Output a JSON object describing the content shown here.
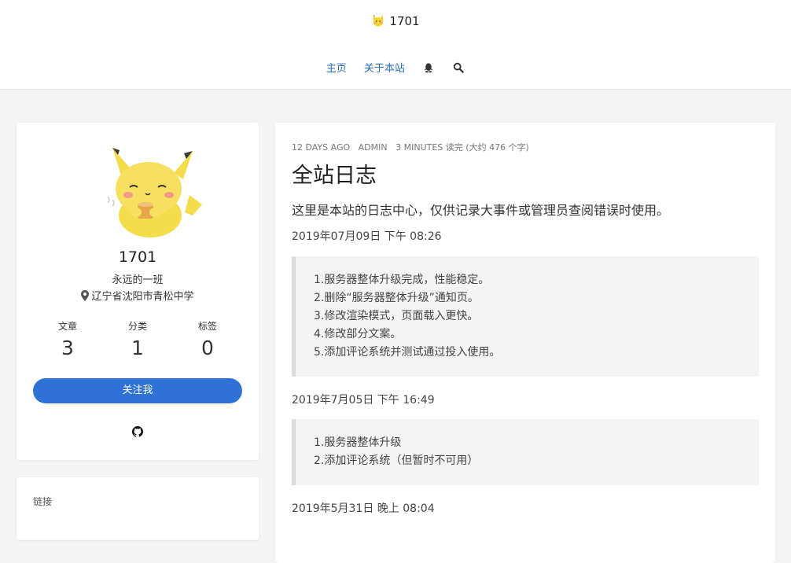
{
  "site": {
    "title": "1701",
    "logo_icon": "pikachu-icon"
  },
  "nav": {
    "home": "主页",
    "about": "关于本站",
    "qq_icon": "qq-icon",
    "search_icon": "search-icon"
  },
  "profile": {
    "avatar_icon": "pikachu-avatar",
    "name": "1701",
    "bio": "永远的一班",
    "location": "辽宁省沈阳市青松中学",
    "stats": [
      {
        "label": "文章",
        "value": "3"
      },
      {
        "label": "分类",
        "value": "1"
      },
      {
        "label": "标签",
        "value": "0"
      }
    ],
    "follow_label": "关注我",
    "github_icon": "github-icon"
  },
  "links": {
    "title": "链接"
  },
  "post": {
    "meta": {
      "ago": "12 DAYS AGO",
      "author": "ADMIN",
      "read": "3 MINUTES 读完 (大约 476 个字)"
    },
    "title": "全站日志",
    "intro": "这里是本站的日志中心，仅供记录大事件或管理员查阅错误时使用。",
    "entries": [
      {
        "date": "2019年07月09日 下午 08:26",
        "lines": [
          "1.服务器整体升级完成，性能稳定。",
          "2.删除“服务器整体升级”通知页。",
          "3.修改渲染模式，页面载入更快。",
          "4.修改部分文案。",
          "5.添加评论系统并测试通过投入使用。"
        ]
      },
      {
        "date": "2019年7月05日 下午 16:49",
        "lines": [
          "1.服务器整体升级",
          "2.添加评论系统（但暂时不可用）"
        ]
      },
      {
        "date": "2019年5月31日 晚上 08:04",
        "lines": []
      }
    ]
  },
  "colors": {
    "accent": "#2f72d6",
    "link": "#2a6ebb",
    "page_bg": "#f4f4f4"
  }
}
